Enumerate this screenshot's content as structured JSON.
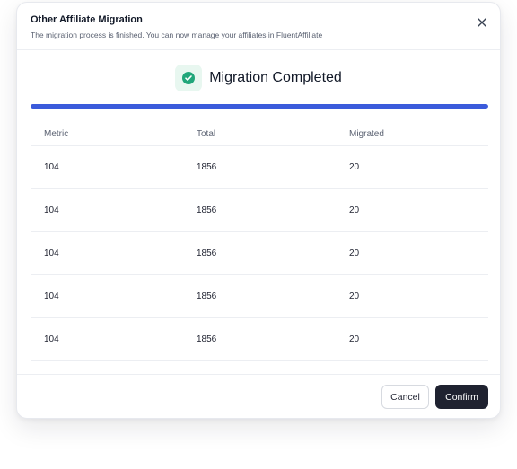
{
  "dialog": {
    "title": "Other Affiliate Migration",
    "subtitle": "The migration process is finished. You can now manage your affiliates in FluentAffiliate",
    "close_icon": "close-icon"
  },
  "status": {
    "icon": "check-circle-icon",
    "text": "Migration Completed",
    "progress_percent": 100,
    "accent_color": "#3b5bdb",
    "success_color": "#21a67a"
  },
  "table": {
    "columns": [
      "Metric",
      "Total",
      "Migrated"
    ],
    "rows": [
      [
        "104",
        "1856",
        "20"
      ],
      [
        "104",
        "1856",
        "20"
      ],
      [
        "104",
        "1856",
        "20"
      ],
      [
        "104",
        "1856",
        "20"
      ],
      [
        "104",
        "1856",
        "20"
      ]
    ]
  },
  "footer": {
    "cancel_label": "Cancel",
    "confirm_label": "Confirm"
  }
}
